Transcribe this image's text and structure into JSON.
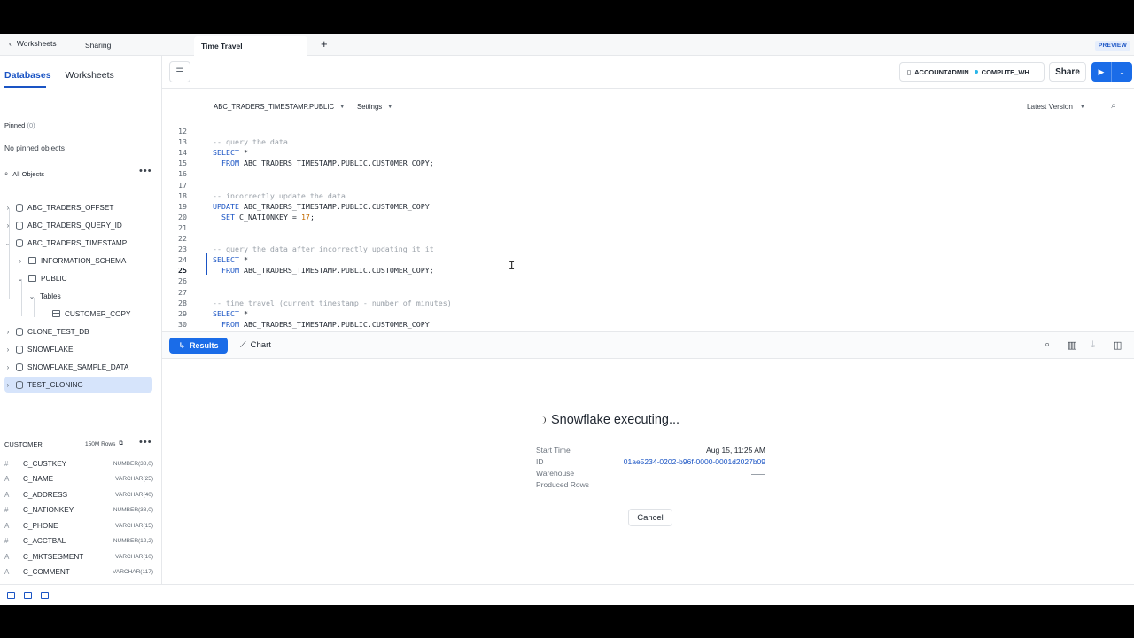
{
  "tabs": {
    "back_label": "Worksheets",
    "sharing_label": "Sharing",
    "active_label": "Time Travel",
    "preview_badge": "PREVIEW"
  },
  "sidebar": {
    "tab_databases": "Databases",
    "tab_worksheets": "Worksheets",
    "pinned_label": "Pinned",
    "pinned_count": "(0)",
    "no_pinned": "No pinned objects",
    "all_objects": "All Objects",
    "tree": [
      {
        "label": "ABC_TRADERS_OFFSET",
        "icon": "database-icon",
        "chevron": "›"
      },
      {
        "label": "ABC_TRADERS_QUERY_ID",
        "icon": "database-icon",
        "chevron": "›"
      },
      {
        "label": "ABC_TRADERS_TIMESTAMP",
        "icon": "database-icon",
        "chevron": "⌄"
      },
      {
        "label": "INFORMATION_SCHEMA",
        "icon": "schema-icon",
        "chevron": "›"
      },
      {
        "label": "PUBLIC",
        "icon": "schema-icon",
        "chevron": "⌄"
      },
      {
        "label": "Tables",
        "icon": "",
        "chevron": "⌄"
      },
      {
        "label": "CUSTOMER_COPY",
        "icon": "table-icon",
        "chevron": ""
      },
      {
        "label": "CLONE_TEST_DB",
        "icon": "database-icon",
        "chevron": "›"
      },
      {
        "label": "SNOWFLAKE",
        "icon": "database-icon",
        "chevron": "›"
      },
      {
        "label": "SNOWFLAKE_SAMPLE_DATA",
        "icon": "database-icon",
        "chevron": "›"
      },
      {
        "label": "TEST_CLONING",
        "icon": "database-icon",
        "chevron": "›"
      }
    ],
    "customer_panel": {
      "title": "CUSTOMER",
      "rows": "150M Rows",
      "columns": [
        {
          "type": "#",
          "name": "C_CUSTKEY",
          "datatype": "NUMBER(38,0)"
        },
        {
          "type": "A",
          "name": "C_NAME",
          "datatype": "VARCHAR(25)"
        },
        {
          "type": "A",
          "name": "C_ADDRESS",
          "datatype": "VARCHAR(40)"
        },
        {
          "type": "#",
          "name": "C_NATIONKEY",
          "datatype": "NUMBER(38,0)"
        },
        {
          "type": "A",
          "name": "C_PHONE",
          "datatype": "VARCHAR(15)"
        },
        {
          "type": "#",
          "name": "C_ACCTBAL",
          "datatype": "NUMBER(12,2)"
        },
        {
          "type": "A",
          "name": "C_MKTSEGMENT",
          "datatype": "VARCHAR(10)"
        },
        {
          "type": "A",
          "name": "C_COMMENT",
          "datatype": "VARCHAR(117)"
        }
      ]
    }
  },
  "toolbar": {
    "role": "ACCOUNTADMIN",
    "warehouse": "COMPUTE_WH",
    "share_label": "Share"
  },
  "editor": {
    "context_path": "ABC_TRADERS_TIMESTAMP.PUBLIC",
    "settings_label": "Settings",
    "version_label": "Latest Version",
    "current_line": "25",
    "lines": [
      {
        "n": "12",
        "text": ""
      },
      {
        "n": "13",
        "text": "-- query the data"
      },
      {
        "n": "14",
        "text": "SELECT *"
      },
      {
        "n": "15",
        "text": "  FROM ABC_TRADERS_TIMESTAMP.PUBLIC.CUSTOMER_COPY;"
      },
      {
        "n": "16",
        "text": ""
      },
      {
        "n": "17",
        "text": ""
      },
      {
        "n": "18",
        "text": "-- incorrectly update the data"
      },
      {
        "n": "19",
        "text": "UPDATE ABC_TRADERS_TIMESTAMP.PUBLIC.CUSTOMER_COPY"
      },
      {
        "n": "20",
        "text": "  SET C_NATIONKEY = 17;"
      },
      {
        "n": "21",
        "text": ""
      },
      {
        "n": "22",
        "text": ""
      },
      {
        "n": "23",
        "text": "-- query the data after incorrectly updating it it"
      },
      {
        "n": "24",
        "text": "SELECT *"
      },
      {
        "n": "25",
        "text": "  FROM ABC_TRADERS_TIMESTAMP.PUBLIC.CUSTOMER_COPY;"
      },
      {
        "n": "26",
        "text": ""
      },
      {
        "n": "27",
        "text": ""
      },
      {
        "n": "28",
        "text": "-- time travel (current timestamp - number of minutes)"
      },
      {
        "n": "29",
        "text": "SELECT *"
      },
      {
        "n": "30",
        "text": "  FROM ABC_TRADERS_TIMESTAMP.PUBLIC.CUSTOMER_COPY"
      }
    ]
  },
  "results": {
    "results_label": "Results",
    "chart_label": "Chart",
    "executing_title": "Snowflake executing...",
    "start_time_label": "Start Time",
    "start_time_value": "Aug 15, 11:25 AM",
    "id_label": "ID",
    "id_value": "01ae5234-0202-b96f-0000-0001d2027b09",
    "warehouse_label": "Warehouse",
    "produced_rows_label": "Produced Rows",
    "cancel_label": "Cancel"
  }
}
